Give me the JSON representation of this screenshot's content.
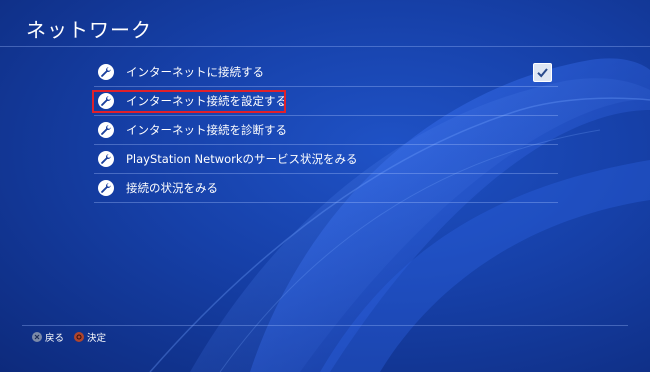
{
  "screen": {
    "title": "ネットワーク"
  },
  "menu": {
    "items": [
      {
        "label": "インターネットに接続する",
        "icon": "wrench-icon",
        "checked": true
      },
      {
        "label": "インターネット接続を設定する",
        "icon": "wrench-icon",
        "highlighted": true
      },
      {
        "label": "インターネット接続を診断する",
        "icon": "wrench-icon"
      },
      {
        "label": "PlayStation Networkのサービス状況をみる",
        "icon": "wrench-icon"
      },
      {
        "label": "接続の状況をみる",
        "icon": "wrench-icon"
      }
    ]
  },
  "footer": {
    "back_label": "戻る",
    "back_icon": "cross-button-icon",
    "confirm_label": "決定",
    "confirm_icon": "circle-button-icon"
  },
  "colors": {
    "background": "#1640a8",
    "highlight_border": "#e0202a",
    "text": "#ffffff"
  }
}
